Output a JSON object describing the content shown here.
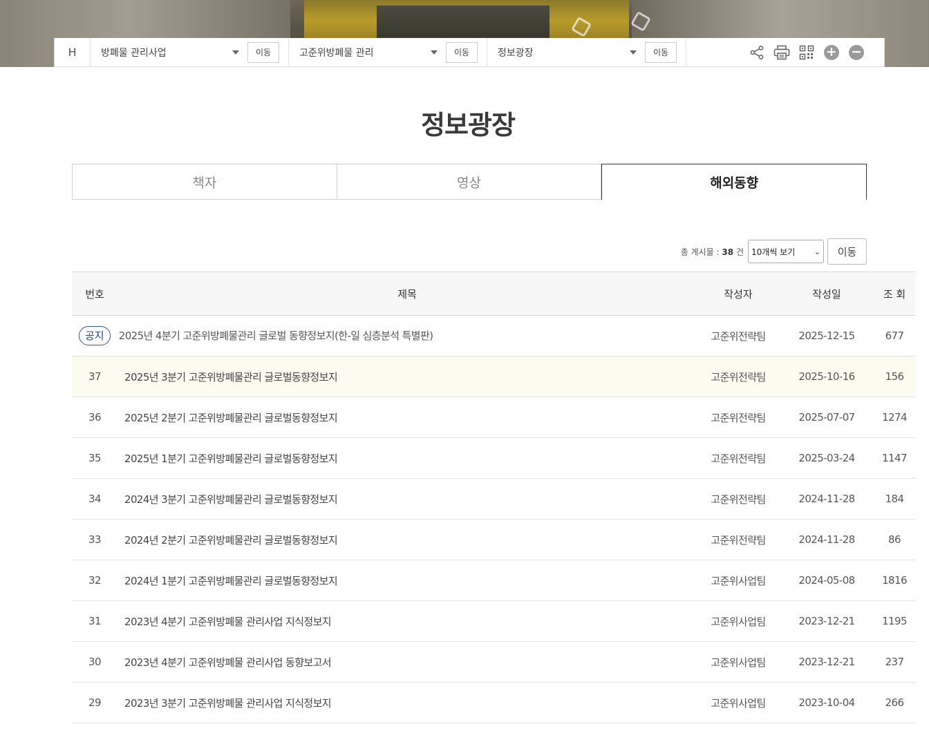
{
  "location_bar": {
    "home": "H",
    "depth1": "방폐물 관리사업",
    "depth2": "고준위방폐물 관리",
    "depth3": "정보광장",
    "go_label": "이동"
  },
  "icons": {
    "share": "share-icon",
    "print": "print-icon",
    "qr": "qr-code-icon",
    "zoom_in": "zoom-in-icon",
    "zoom_out": "zoom-out-icon"
  },
  "page": {
    "title": "정보광장"
  },
  "tabs": [
    {
      "label": "책자"
    },
    {
      "label": "영상"
    },
    {
      "label": "해외동향"
    }
  ],
  "board": {
    "total_label": "총 게시물 :",
    "total_count": "38",
    "total_unit": "건",
    "per_page": "10개씩 보기",
    "go_label": "이동",
    "columns": {
      "no": "번호",
      "title": "제목",
      "author": "작성자",
      "date": "작성일",
      "views": "조 회"
    },
    "notice_badge": "공지",
    "rows": [
      {
        "no": "",
        "title": "2025년 4분기 고준위방폐물관리 글로벌 동향정보지(한-일 심층분석 특별판)",
        "author": "고준위전략팀",
        "date": "2025-12-15",
        "views": "677"
      },
      {
        "no": "37",
        "title": "2025년 3분기 고준위방폐물관리 글로벌동향정보지",
        "author": "고준위전략팀",
        "date": "2025-10-16",
        "views": "156"
      },
      {
        "no": "36",
        "title": "2025년 2분기 고준위방폐물관리 글로벌동향정보지",
        "author": "고준위전략팀",
        "date": "2025-07-07",
        "views": "1274"
      },
      {
        "no": "35",
        "title": "2025년 1분기 고준위방폐물관리 글로벌동향정보지",
        "author": "고준위전략팀",
        "date": "2025-03-24",
        "views": "1147"
      },
      {
        "no": "34",
        "title": "2024년 3분기 고준위방폐물관리 글로벌동향정보지",
        "author": "고준위전략팀",
        "date": "2024-11-28",
        "views": "184"
      },
      {
        "no": "33",
        "title": "2024년 2분기 고준위방폐물관리 글로벌동향정보지",
        "author": "고준위전략팀",
        "date": "2024-11-28",
        "views": "86"
      },
      {
        "no": "32",
        "title": "2024년 1분기 고준위방폐물관리 글로벌동향정보지",
        "author": "고준위사업팀",
        "date": "2024-05-08",
        "views": "1816"
      },
      {
        "no": "31",
        "title": "2023년 4분기 고준위방폐물 관리사업 지식정보지",
        "author": "고준위사업팀",
        "date": "2023-12-21",
        "views": "1195"
      },
      {
        "no": "30",
        "title": "2023년 4분기 고준위방폐물 관리사업 동향보고서",
        "author": "고준위사업팀",
        "date": "2023-12-21",
        "views": "237"
      },
      {
        "no": "29",
        "title": "2023년 3분기 고준위방폐물 관리사업 지식정보지",
        "author": "고준위사업팀",
        "date": "2023-10-04",
        "views": "266"
      }
    ]
  }
}
